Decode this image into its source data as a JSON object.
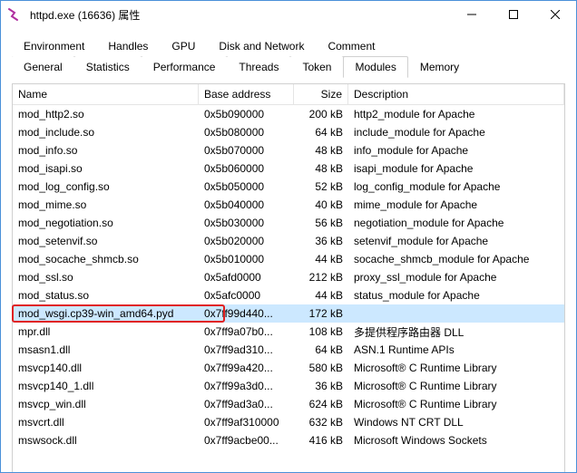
{
  "window": {
    "title": "httpd.exe (16636) 属性"
  },
  "tabs": {
    "row1": [
      "Environment",
      "Handles",
      "GPU",
      "Disk and Network",
      "Comment"
    ],
    "row2": [
      "General",
      "Statistics",
      "Performance",
      "Threads",
      "Token",
      "Modules",
      "Memory"
    ]
  },
  "columns": [
    "Name",
    "Base address",
    "Size",
    "Description"
  ],
  "highlightIndex": 12,
  "rows": [
    {
      "name": "mod_http2.so",
      "addr": "0x5b090000",
      "size": "200 kB",
      "desc": "http2_module for Apache"
    },
    {
      "name": "mod_include.so",
      "addr": "0x5b080000",
      "size": "64 kB",
      "desc": "include_module for Apache"
    },
    {
      "name": "mod_info.so",
      "addr": "0x5b070000",
      "size": "48 kB",
      "desc": "info_module for Apache"
    },
    {
      "name": "mod_isapi.so",
      "addr": "0x5b060000",
      "size": "48 kB",
      "desc": "isapi_module for Apache"
    },
    {
      "name": "mod_log_config.so",
      "addr": "0x5b050000",
      "size": "52 kB",
      "desc": "log_config_module for Apache"
    },
    {
      "name": "mod_mime.so",
      "addr": "0x5b040000",
      "size": "40 kB",
      "desc": "mime_module for Apache"
    },
    {
      "name": "mod_negotiation.so",
      "addr": "0x5b030000",
      "size": "56 kB",
      "desc": "negotiation_module for Apache"
    },
    {
      "name": "mod_setenvif.so",
      "addr": "0x5b020000",
      "size": "36 kB",
      "desc": "setenvif_module for Apache"
    },
    {
      "name": "mod_socache_shmcb.so",
      "addr": "0x5b010000",
      "size": "44 kB",
      "desc": "socache_shmcb_module for Apache"
    },
    {
      "name": "mod_ssl.so",
      "addr": "0x5afd0000",
      "size": "212 kB",
      "desc": "proxy_ssl_module for Apache"
    },
    {
      "name": "mod_status.so",
      "addr": "0x5afc0000",
      "size": "44 kB",
      "desc": "status_module for Apache"
    },
    {
      "name": "mod_wsgi.cp39-win_amd64.pyd",
      "addr": "0x7ff99d440...",
      "size": "172 kB",
      "desc": "",
      "sel": true
    },
    {
      "name": "mpr.dll",
      "addr": "0x7ff9a07b0...",
      "size": "108 kB",
      "desc": "多提供程序路由器 DLL"
    },
    {
      "name": "msasn1.dll",
      "addr": "0x7ff9ad310...",
      "size": "64 kB",
      "desc": "ASN.1 Runtime APIs"
    },
    {
      "name": "msvcp140.dll",
      "addr": "0x7ff99a420...",
      "size": "580 kB",
      "desc": "Microsoft® C Runtime Library"
    },
    {
      "name": "msvcp140_1.dll",
      "addr": "0x7ff99a3d0...",
      "size": "36 kB",
      "desc": "Microsoft® C Runtime Library"
    },
    {
      "name": "msvcp_win.dll",
      "addr": "0x7ff9ad3a0...",
      "size": "624 kB",
      "desc": "Microsoft® C Runtime Library"
    },
    {
      "name": "msvcrt.dll",
      "addr": "0x7ff9af310000",
      "size": "632 kB",
      "desc": "Windows NT CRT DLL"
    },
    {
      "name": "mswsock.dll",
      "addr": "0x7ff9acbe00...",
      "size": "416 kB",
      "desc": "Microsoft Windows Sockets"
    }
  ]
}
